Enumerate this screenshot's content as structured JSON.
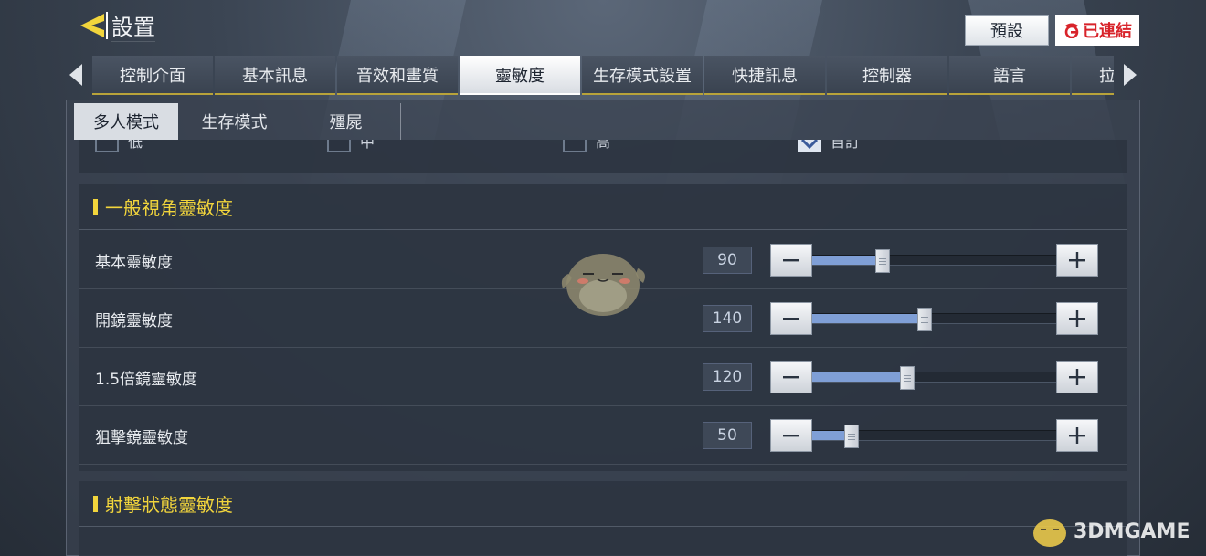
{
  "header": {
    "title": "設置",
    "preset_label": "預設",
    "connect_label": "已連結"
  },
  "tabs": [
    {
      "label": "控制介面",
      "active": false
    },
    {
      "label": "基本訊息",
      "active": false
    },
    {
      "label": "音效和畫質",
      "active": false
    },
    {
      "label": "靈敏度",
      "active": true
    },
    {
      "label": "生存模式設置",
      "active": false
    },
    {
      "label": "快捷訊息",
      "active": false
    },
    {
      "label": "控制器",
      "active": false
    },
    {
      "label": "語言",
      "active": false
    },
    {
      "label": "拉",
      "active": false
    }
  ],
  "subtabs": [
    {
      "label": "多人模式",
      "active": true
    },
    {
      "label": "生存模式",
      "active": false
    },
    {
      "label": "殭屍",
      "active": false
    }
  ],
  "options": [
    {
      "label": "低",
      "checked": false
    },
    {
      "label": "中",
      "checked": false
    },
    {
      "label": "高",
      "checked": false
    },
    {
      "label": "自訂",
      "checked": true
    }
  ],
  "section1": {
    "title": "一般視角靈敏度",
    "rows": [
      {
        "label": "基本靈敏度",
        "value": "90",
        "level": 0.29
      },
      {
        "label": "開鏡靈敏度",
        "value": "140",
        "level": 0.46
      },
      {
        "label": "1.5倍鏡靈敏度",
        "value": "120",
        "level": 0.39
      },
      {
        "label": "狙擊鏡靈敏度",
        "value": "50",
        "level": 0.16
      }
    ]
  },
  "section2": {
    "title": "射擊狀態靈敏度"
  },
  "watermark": {
    "text": "3DMGAME"
  },
  "colors": {
    "accent_yellow": "#f2d53c",
    "slider_fill": "#7f9fd6",
    "brand_red": "#d8232a"
  }
}
